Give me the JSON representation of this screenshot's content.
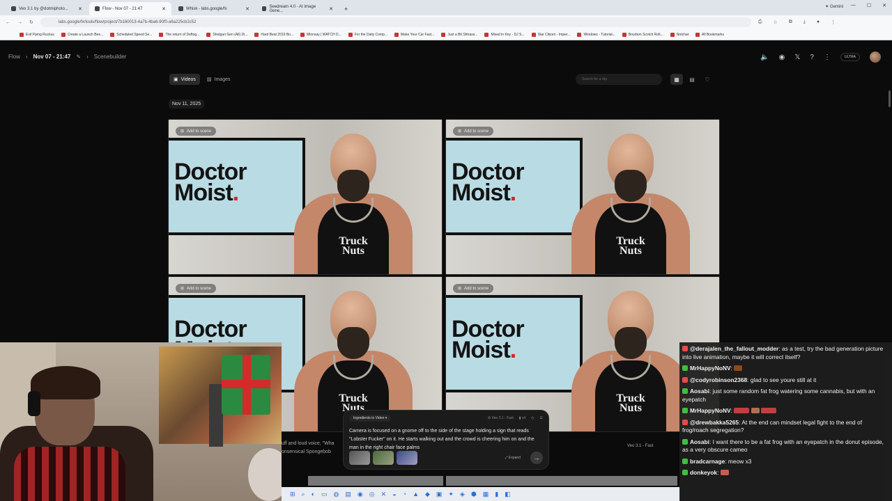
{
  "browser": {
    "tabs": [
      {
        "label": "Veo 3.1 by @dotmiphoto..."
      },
      {
        "label": "Flow - Nov 07 - 21:47"
      },
      {
        "label": "Whisk - labs.google/fx"
      },
      {
        "label": "Seedream 4.0 - AI Image Gene..."
      }
    ],
    "gemini": "Gemini",
    "url": "labs.google/fx/tools/flow/project/7b160013-4a7b-4ba6-90f0-a6a225cb2c52",
    "bookmarks": [
      "Evil Flying Ruckus",
      "Create a Launch Bee...",
      "Scheduled Speed Se...",
      "The return of Deftog...",
      "Shotgun Gen (All) Di...",
      "Hard Beat 2019 Bo...",
      "Mlonsay | WATCH D...",
      "For the Daily Comp...",
      "Make Your Car Fast...",
      "Just a Bit Shtrass...",
      "Mixed in Key - DJ S...",
      "Star Citizen - Imper...",
      "Windows - Tutorial...",
      "Bourbon Scotch Rolt...",
      "Notchat",
      "All Bookmarks"
    ]
  },
  "app": {
    "breadcrumb_root": "Flow",
    "breadcrumb_current": "Nov 07 - 21:47",
    "breadcrumb_tab": "Scenebuilder",
    "ultra_badge": "ULTRA",
    "tab_videos": "Videos",
    "tab_images": "Images",
    "search_placeholder": "Search for a clip",
    "date_group": "Nov 11, 2025",
    "card_action": "Add to scene",
    "logo_line1": "Doctor",
    "logo_line2": "Moist",
    "logo_dot": ".",
    "tank_line1": "Truck",
    "tank_line2": "Nuts"
  },
  "prompt": {
    "mode": "Ingredients to Video",
    "model": "Veo 3.1 - Fast",
    "count": "x4",
    "text": "Camera is focused on a gnome off to the side of the stage holding a sign that reads \"Lobster Fucker\" on it. He starts walking out and the crowd is cheering him on and the man in the right chair face palms",
    "expand": "Expand",
    "send_icon": "arrow-right-icon"
  },
  "stray": {
    "left_text_1": "uff and loud voice, \"Wha",
    "left_text_2": "onsensical Spongebob",
    "right_text": "Veo 3.1 - Fast"
  },
  "chat": [
    {
      "user": "@derajalen_the_fallout_modder",
      "color": "#e84a4a",
      "text": ": as a test, try the bad generation picture into live animation, maybe it will correct itself?"
    },
    {
      "user": "MrHappyNoNV",
      "color": "#3fbf3f",
      "text": ":"
    },
    {
      "user": "@codyrobinson2368",
      "color": "#e84a4a",
      "text": ": glad to see youre still at it"
    },
    {
      "user": "Aosabi",
      "color": "#3fbf3f",
      "text": ": just some random fat frog watering some cannabis, but with an eyepatch"
    },
    {
      "user": "MrHappyNoNV",
      "color": "#3fbf3f",
      "text": ":"
    },
    {
      "user": "@drewbakka5265",
      "color": "#e84a4a",
      "text": ": At the end can mindset legal fight to the end of frog/roach segregation?"
    },
    {
      "user": "Aosabi",
      "color": "#3fbf3f",
      "text": ": I want there to be a fat frog with an eyepatch in the donut episode, as a very obscure cameo"
    },
    {
      "user": "bradcarnage",
      "color": "#3fbf3f",
      "text": ": meow x3"
    },
    {
      "user": "donkeyok",
      "color": "#3fbf3f",
      "text": ":"
    }
  ]
}
